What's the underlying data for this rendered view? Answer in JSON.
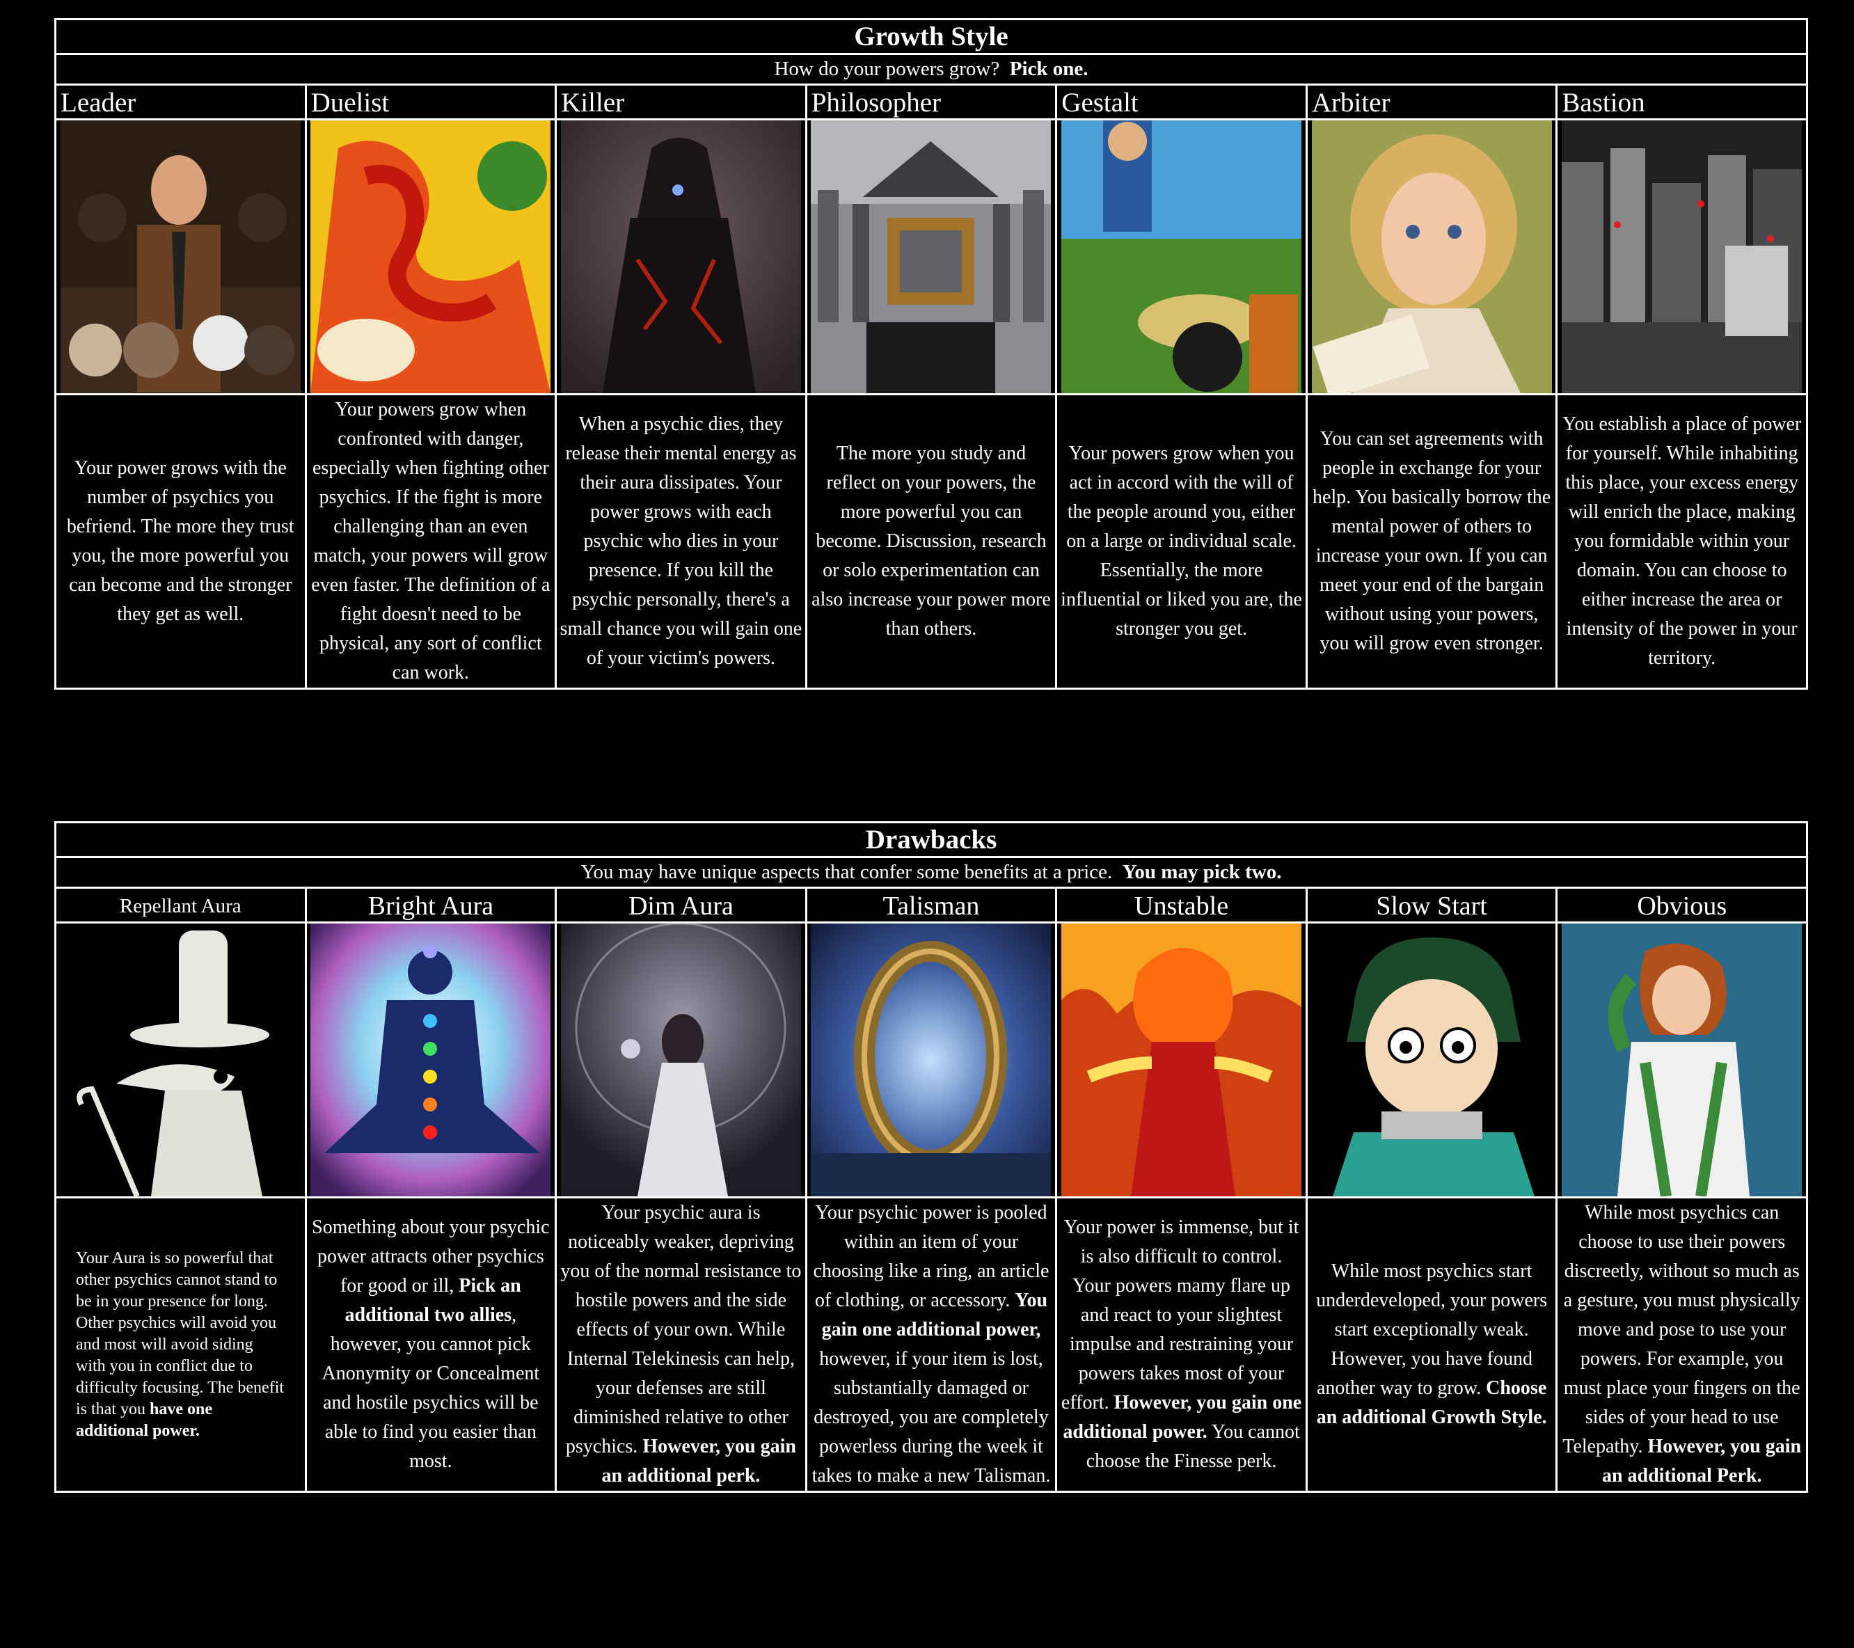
{
  "growth": {
    "title": "Growth Style",
    "subtitle_pre": "How do your powers grow?",
    "subtitle_bold": "Pick one.",
    "options": [
      {
        "name": "Leader",
        "text": "Your power grows with the number of psychics you befriend. The more they trust you, the more powerful you can become and the stronger they get as well."
      },
      {
        "name": "Duelist",
        "text": "Your powers grow when confronted with danger, especially when fighting other psychics.  If the fight is more challenging than an even match, your powers will grow even faster.  The definition of a fight doesn't need to be physical, any sort of conflict can work."
      },
      {
        "name": "Killer",
        "text": "When a psychic dies, they release their mental energy as their aura dissipates.  Your power grows with each psychic who dies in your presence.  If you kill the psychic personally, there's a small chance you will gain one of your victim's powers."
      },
      {
        "name": "Philosopher",
        "text": "The more you study and reflect on your powers, the more powerful you can become.  Discussion, research or solo experimentation can also increase your power more than others."
      },
      {
        "name": "Gestalt",
        "text": "Your powers grow when you act in accord with the will of the people around you, either on a large or individual scale.  Essentially, the more influential or liked you are, the stronger you get."
      },
      {
        "name": "Arbiter",
        "text": "You can set agreements with people in exchange for your help.  You basically borrow the mental power of others to increase your own.  If you can meet your end of the bargain without using your powers, you will grow even stronger."
      },
      {
        "name": "Bastion",
        "text": "You establish a place of power for yourself.  While inhabiting this place, your excess energy will enrich the place, making you formidable within your domain.  You can choose to either increase the area or intensity of the power in your territory."
      }
    ]
  },
  "drawbacks": {
    "title": "Drawbacks",
    "subtitle_pre": "You may have unique aspects that confer some benefits at a price.",
    "subtitle_bold": "You may pick two.",
    "options": [
      {
        "name": "Repellant Aura",
        "text": "Your Aura is so powerful that other psychics cannot stand to be in your presence for long.  Other psychics will avoid you and most will avoid siding with you in conflict due to difficulty focusing.  The benefit is that you",
        "bold": "have one additional power.",
        "after": ""
      },
      {
        "name": "Bright Aura",
        "text": "Something about your psychic power attracts other psychics for good or ill,",
        "bold": "Pick an additional two allies",
        "after": ", however, you cannot pick Anonymity or Concealment and hostile psychics will be able to find you easier than most."
      },
      {
        "name": "Dim Aura",
        "text": "Your psychic aura is noticeably weaker, depriving you of the normal resistance to hostile powers and the side effects of your own.  While Internal Telekinesis can help, your defenses are still diminished relative to other psychics.",
        "bold": "However, you gain an additional perk.",
        "after": ""
      },
      {
        "name": "Talisman",
        "text": "Your psychic power is pooled within an item of your choosing like a ring, an article of clothing, or accessory.",
        "bold": "You gain one additional power,",
        "after": " however, if your item is lost, substantially damaged or destroyed, you are completely powerless during the week it takes to make a new Talisman."
      },
      {
        "name": "Unstable",
        "text": "Your power is immense, but it is also difficult to control. Your powers mamy flare up and react to your slightest impulse and restraining your powers takes most of your effort.",
        "bold": "However, you gain one additional power.",
        "after": "  You cannot choose the Finesse perk."
      },
      {
        "name": "Slow Start",
        "text": "While most psychics start underdeveloped, your powers start exceptionally weak.  However, you have found another way to grow.",
        "bold": "Choose an additional Growth Style.",
        "after": ""
      },
      {
        "name": "Obvious",
        "text": "While most psychics can choose to use their powers discreetly, without so much as a gesture, you must physically move and pose to use your powers.  For example, you must place your fingers on the sides of your head to use Telepathy.",
        "bold": "However, you gain an additional Perk.",
        "after": ""
      }
    ]
  }
}
